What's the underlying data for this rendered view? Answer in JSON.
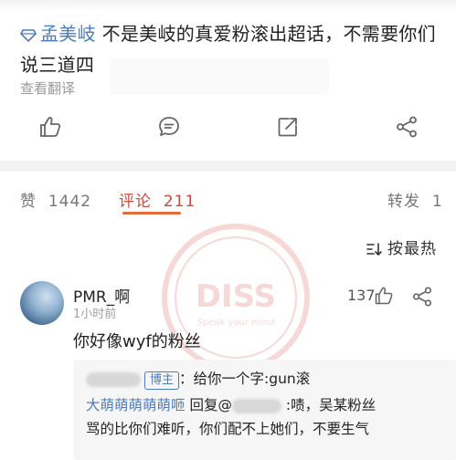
{
  "post": {
    "mention": "孟美岐",
    "text_line1": " 不是美岐的真爱粉滚出超话，不需要你们",
    "text_line2": "说三道四",
    "translate_label": "查看翻译"
  },
  "tabs": {
    "likes_label": "赞",
    "likes_count": "1442",
    "comments_label": "评论",
    "comments_count": "211",
    "reposts_label": "转发",
    "reposts_count": "1"
  },
  "sort": {
    "label": "按最热"
  },
  "comment": {
    "username": "PMR_啊",
    "time": "1小时前",
    "likes": "137",
    "text": "你好像wyf的粉丝"
  },
  "replies": [
    {
      "badge": "博主",
      "text": "：给你一个字:gun滚"
    },
    {
      "author": "大萌萌萌萌萌咂",
      "action": " 回复@",
      "text": " :啧，吴某粉丝"
    },
    {
      "text": "骂的比你们难听，你们配不上她们，不要生气"
    }
  ],
  "watermark": {
    "main": "DISS",
    "sub": "Speak your mind"
  },
  "colors": {
    "accent": "#c94a3b",
    "link": "#4d7cb8",
    "underline": "#e56c3a"
  }
}
